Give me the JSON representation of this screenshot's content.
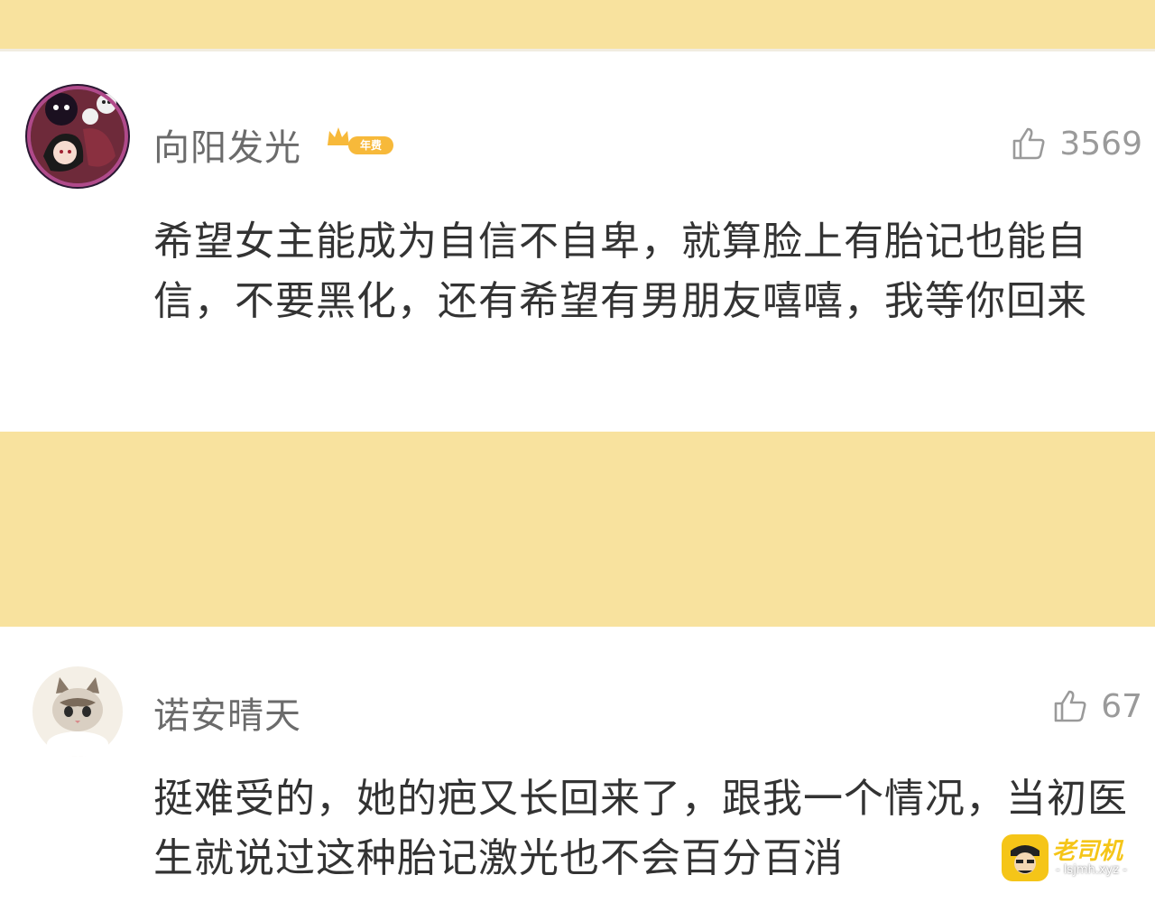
{
  "comments": [
    {
      "username": "向阳发光",
      "badge_label": "年费",
      "like_icon": "thumbs-up-icon",
      "likes": "3569",
      "text": "希望女主能成为自信不自卑，就算脸上有胎记也能自信，不要黑化，还有希望有男朋友嘻嘻，我等你回来"
    },
    {
      "username": "诺安晴天",
      "like_icon": "thumbs-up-icon",
      "likes": "67",
      "text": "挺难受的，她的疤又长回来了，跟我一个情况，当初医生就说过这种胎记激光也不会百分百消"
    }
  ],
  "watermark": {
    "brand": "老司机",
    "domain": "- lsjmh.xyz -"
  },
  "colors": {
    "banner": "#f8e29e",
    "username": "#6b6b6b",
    "text": "#333333",
    "like": "#9a9a9a",
    "vip": "#f7b93a"
  }
}
